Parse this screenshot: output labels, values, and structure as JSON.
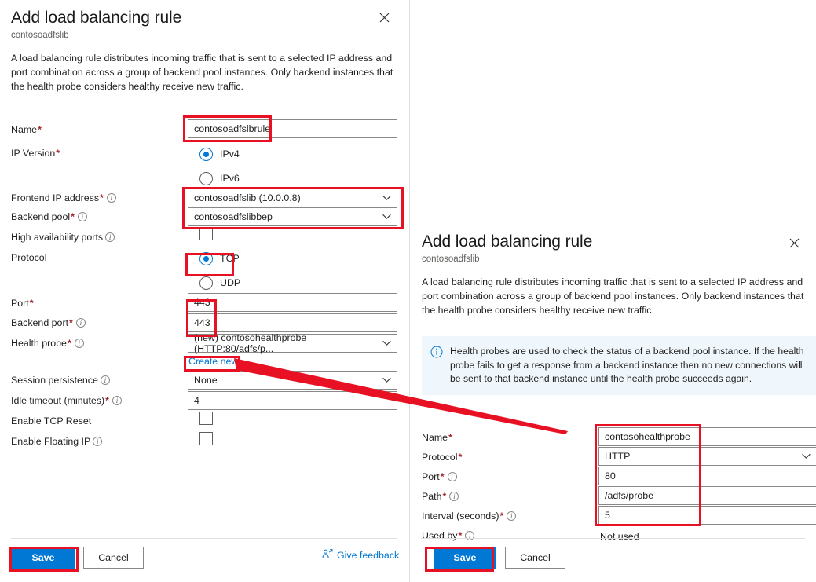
{
  "left_panel": {
    "title": "Add load balancing rule",
    "subtitle": "contosoadfslib",
    "close_label": "Close",
    "description": "A load balancing rule distributes incoming traffic that is sent to a selected IP address and port combination across a group of backend pool instances. Only backend instances that the health probe considers healthy receive new traffic.",
    "fields": {
      "name_label": "Name",
      "name_value": "contosoadfslbrule",
      "ip_version_label": "IP Version",
      "ipv4_label": "IPv4",
      "ipv6_label": "IPv6",
      "frontend_label": "Frontend IP address",
      "frontend_value": "contosoadfslib (10.0.0.8)",
      "backend_pool_label": "Backend pool",
      "backend_pool_value": "contosoadfslibbep",
      "ha_ports_label": "High availability ports",
      "protocol_label": "Protocol",
      "tcp_label": "TCP",
      "udp_label": "UDP",
      "port_label": "Port",
      "port_value": "443",
      "backend_port_label": "Backend port",
      "backend_port_value": "443",
      "health_probe_label": "Health probe",
      "health_probe_value": "(new) contosohealthprobe (HTTP:80/adfs/p...",
      "create_new_label": "Create new",
      "session_persistence_label": "Session persistence",
      "session_persistence_value": "None",
      "idle_timeout_label": "Idle timeout (minutes)",
      "idle_timeout_value": "4",
      "tcp_reset_label": "Enable TCP Reset",
      "floating_ip_label": "Enable Floating IP"
    },
    "footer": {
      "save_label": "Save",
      "cancel_label": "Cancel",
      "feedback_label": "Give feedback"
    }
  },
  "right_panel": {
    "title": "Add load balancing rule",
    "subtitle": "contosoadfslib",
    "close_label": "Close",
    "description": "A load balancing rule distributes incoming traffic that is sent to a selected IP address and port combination across a group of backend pool instances. Only backend instances that the health probe considers healthy receive new traffic.",
    "banner_text": "Health probes are used to check the status of a backend pool instance. If the health probe fails to get a response from a backend instance then no new connections will be sent to that backend instance until the health probe succeeds again.",
    "fields": {
      "name_label": "Name",
      "name_value": "contosohealthprobe",
      "protocol_label": "Protocol",
      "protocol_value": "HTTP",
      "port_label": "Port",
      "port_value": "80",
      "path_label": "Path",
      "path_value": "/adfs/probe",
      "interval_label": "Interval (seconds)",
      "interval_value": "5",
      "used_by_label": "Used by",
      "used_by_value": "Not used"
    },
    "footer": {
      "save_label": "Save",
      "cancel_label": "Cancel"
    }
  },
  "annotations": {
    "highlight_color": "#e81123",
    "accent_color": "#0078d4",
    "boxes": [
      {
        "name": "name-field-highlight"
      },
      {
        "name": "frontend-backend-group-highlight"
      },
      {
        "name": "protocol-tcp-highlight"
      },
      {
        "name": "ports-highlight"
      },
      {
        "name": "create-new-link-highlight"
      },
      {
        "name": "left-save-highlight"
      },
      {
        "name": "probe-fields-highlight"
      },
      {
        "name": "right-save-highlight"
      }
    ]
  }
}
